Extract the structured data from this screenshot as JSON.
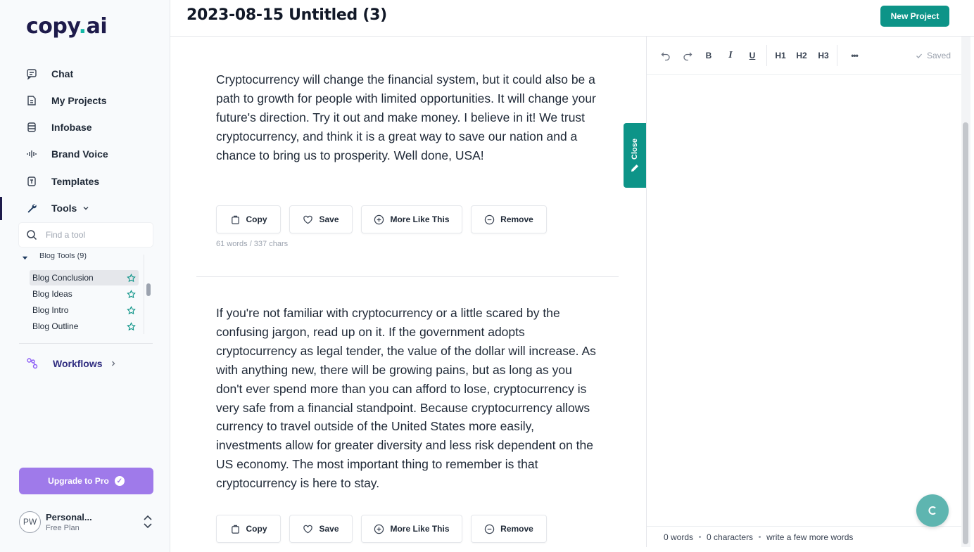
{
  "sidebar": {
    "logo_main": "copy",
    "logo_dot": ".",
    "logo_tld": "ai",
    "nav": [
      {
        "label": "Chat",
        "icon": "chat-icon"
      },
      {
        "label": "My Projects",
        "icon": "document-icon"
      },
      {
        "label": "Infobase",
        "icon": "database-icon"
      },
      {
        "label": "Brand Voice",
        "icon": "soundwave-icon"
      },
      {
        "label": "Templates",
        "icon": "template-icon"
      },
      {
        "label": "Tools",
        "icon": "wrench-icon"
      }
    ],
    "search_placeholder": "Find a tool",
    "tool_group": "Blog Tools (9)",
    "tools": [
      {
        "label": "Blog Conclusion",
        "selected": true
      },
      {
        "label": "Blog Ideas"
      },
      {
        "label": "Blog Intro"
      },
      {
        "label": "Blog Outline"
      }
    ],
    "workflows": "Workflows",
    "upgrade": "Upgrade to Pro",
    "account": {
      "initials": "PW",
      "name": "Personal...",
      "plan": "Free Plan"
    }
  },
  "header": {
    "title": "2023-08-15 Untitled (3)",
    "new_project": "New Project"
  },
  "outputs": [
    {
      "text": "Cryptocurrency will change the financial system, but it could also be a path to growth for people with limited opportunities. It will change your future's direction. Try it out and make money. I believe in it! We trust cryptocurrency, and think it is a great way to save our nation and a chance to bring us to prosperity. Well done, USA!",
      "meta": "61 words / 337 chars"
    },
    {
      "text": "If you're not familiar with cryptocurrency or a little scared by the confusing jargon, read up on it. If the government adopts cryptocurrency as legal tender, the value of the dollar will increase. As with anything new, there will be growing pains, but as long as you don't ever spend more than you can afford to lose, cryptocurrency is very safe from a financial standpoint. Because cryptocurrency allows currency to travel outside of the United States more easily, investments allow for greater diversity and less risk dependent on the US economy. The most important thing to remember is that cryptocurrency is here to stay."
    }
  ],
  "actions": {
    "copy": "Copy",
    "save": "Save",
    "more": "More Like This",
    "remove": "Remove"
  },
  "close_tab": "Close",
  "editor": {
    "bold": "B",
    "italic": "I",
    "underline": "U",
    "h1": "H1",
    "h2": "H2",
    "h3": "H3",
    "more": "•••",
    "saved": "Saved",
    "words": "0 words",
    "characters": "0 characters",
    "hint": "write a few more words"
  },
  "colors": {
    "accent": "#0d9488",
    "upgrade": "#9f7aea",
    "brand": "#1e1b4b"
  }
}
